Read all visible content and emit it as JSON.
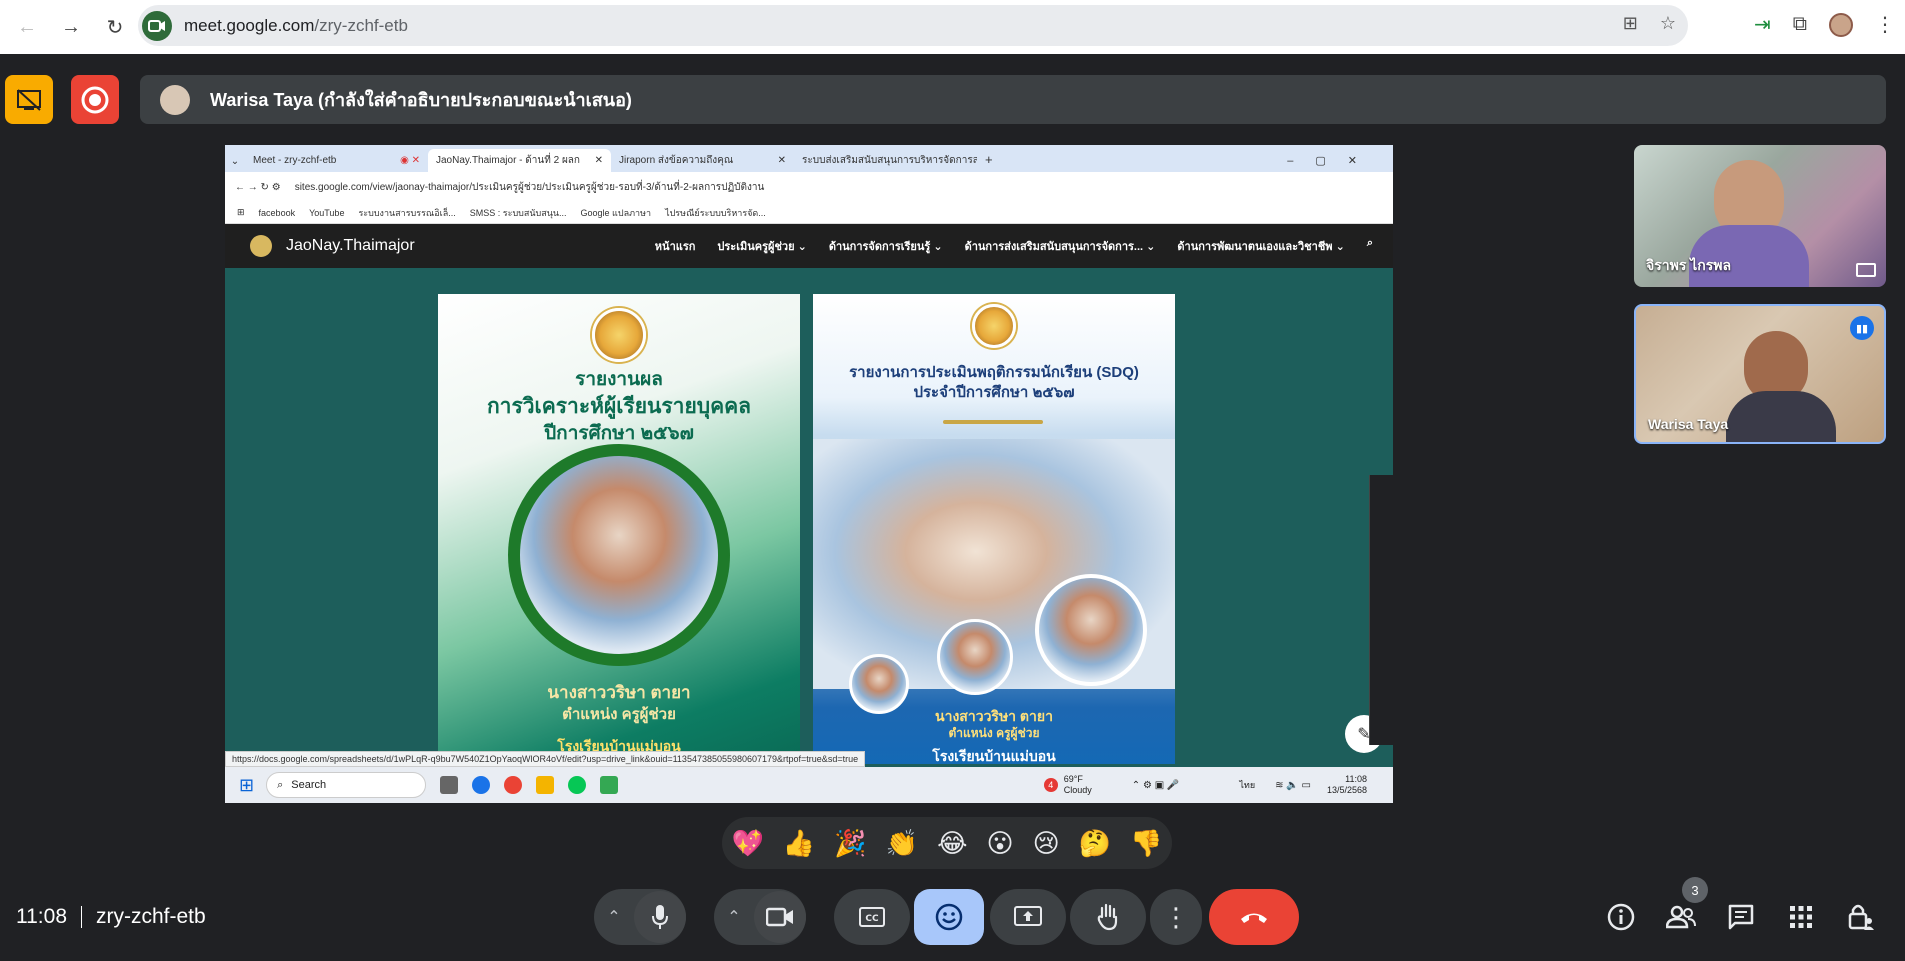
{
  "browser": {
    "url_host": "meet.google.com",
    "url_path": "/zry-zchf-etb"
  },
  "presenter_bar": {
    "text": "Warisa Taya (กำลังใส่คำอธิบายประกอบขณะนำเสนอ)"
  },
  "shared_screen": {
    "tabs": [
      {
        "label": "Meet - zry-zchf-etb"
      },
      {
        "label": "JaoNay.Thaimajor - ด้านที่ 2 ผลก"
      },
      {
        "label": "Jiraporn ส่งข้อความถึงคุณ"
      },
      {
        "label": "ระบบส่งเสริมสนับสนุนการบริหารจัดการสถา"
      }
    ],
    "address": "sites.google.com/view/jaonay-thaimajor/ประเมินครูผู้ช่วย/ประเมินครูผู้ช่วย-รอบที่-3/ด้านที่-2-ผลการปฏิบัติงาน",
    "bookmarks": [
      "facebook",
      "YouTube",
      "ระบบงานสารบรรณอิเล็...",
      "SMSS : ระบบสนับสนุน...",
      "Google แปลภาษา",
      "ไปรษณีย์ระบบบริหารจัด..."
    ],
    "site_name": "JaoNay.Thaimajor",
    "site_nav": [
      "หน้าแรก",
      "ประเมินครูผู้ช่วย",
      "ด้านการจัดการเรียนรู้",
      "ด้านการส่งเสริมสนับสนุนการจัดการ...",
      "ด้านการพัฒนาตนเองและวิชาชีพ"
    ],
    "poster1": {
      "line1": "รายงานผล",
      "line2": "การวิเคราะห์ผู้เรียนรายบุคคล",
      "line3": "ปีการศึกษา ๒๕๖๗",
      "name": "นางสาววริษา   ตายา",
      "position": "ตำแหน่ง ครูผู้ช่วย",
      "school": "โรงเรียนบ้านแม่บอน"
    },
    "poster2": {
      "line1": "รายงานการประเมินพฤติกรรมนักเรียน (SDQ)",
      "line2": "ประจำปีการศึกษา ๒๕๖๗",
      "name": "นางสาววริษา   ตายา",
      "position": "ตำแหน่ง ครูผู้ช่วย",
      "school": "โรงเรียนบ้านแม่บอน"
    },
    "status_url": "https://docs.google.com/spreadsheets/d/1wPLqR-q9bu7W540Z1OpYaoqWlOR4oVf/edit?usp=drive_link&ouid=113547385055980607179&rtpof=true&sd=true",
    "taskbar": {
      "search": "Search",
      "weather_temp": "69°F",
      "weather_text": "Cloudy",
      "weather_badge": "4",
      "lang": "ไทย",
      "time": "11:08",
      "date": "13/5/2568"
    }
  },
  "participants": [
    {
      "name": "จิราพร ไกรพล"
    },
    {
      "name": "Warisa Taya"
    }
  ],
  "reactions": [
    "💖",
    "👍",
    "🎉",
    "👏",
    "😂",
    "😮",
    "😢",
    "🤔",
    "👎"
  ],
  "meeting": {
    "time": "11:08",
    "code": "zry-zchf-etb",
    "people_count": "3"
  },
  "colors": {
    "end_call": "#ea4335",
    "emoji_active": "#a8c7fa",
    "present_badge": "#f9ab00"
  }
}
